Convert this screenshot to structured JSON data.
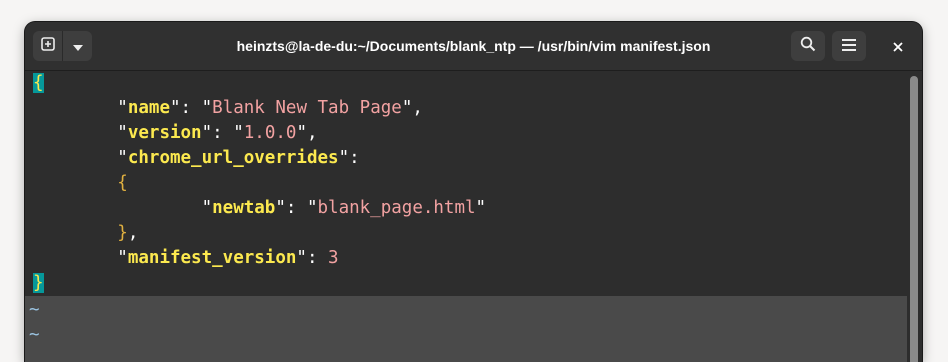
{
  "window": {
    "title": "heinzts@la-de-du:~/Documents/blank_ntp — /usr/bin/vim manifest.json"
  },
  "headerbar": {
    "new_tab_icon": "plus-square-icon",
    "dropdown_icon": "chevron-down-icon",
    "search_icon": "search-icon",
    "menu_icon": "hamburger-menu-icon",
    "close_icon": "close-icon"
  },
  "editor": {
    "lines": [
      {
        "type": "brace_open",
        "text": "{"
      },
      {
        "indent": "        ",
        "key": "name",
        "value": "Blank New Tab Page",
        "value_type": "string",
        "trail": ","
      },
      {
        "indent": "        ",
        "key": "version",
        "value": "1.0.0",
        "value_type": "string",
        "trail": ","
      },
      {
        "indent": "        ",
        "key": "chrome_url_overrides",
        "value": "",
        "value_type": "object_start",
        "trail": ":"
      },
      {
        "indent": "        ",
        "text": "{"
      },
      {
        "indent": "                ",
        "key": "newtab",
        "value": "blank_page.html",
        "value_type": "string",
        "trail": ""
      },
      {
        "indent": "        ",
        "text": "},"
      },
      {
        "indent": "        ",
        "key": "manifest_version",
        "value": "3",
        "value_type": "number",
        "trail": ""
      },
      {
        "type": "brace_close",
        "text": "}"
      }
    ],
    "tildes": [
      "~",
      "~"
    ]
  },
  "colors": {
    "background": "#2d2d2d",
    "key": "#fce94f",
    "string": "#f2a2a2",
    "brace": "#e0b040",
    "match_highlight": "#06989a",
    "tilde": "#9bc4e2"
  }
}
